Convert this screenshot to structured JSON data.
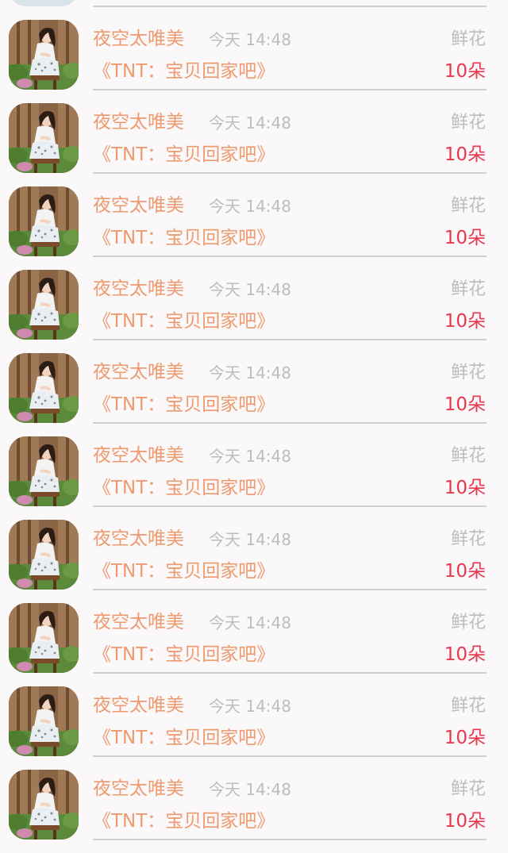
{
  "rows": [
    {
      "name": "夜空太唯美",
      "time": "今天 14:48",
      "gift_label": "鲜花",
      "title": "《TNT：宝贝回家吧》",
      "count": "10朵"
    },
    {
      "name": "夜空太唯美",
      "time": "今天 14:48",
      "gift_label": "鲜花",
      "title": "《TNT：宝贝回家吧》",
      "count": "10朵"
    },
    {
      "name": "夜空太唯美",
      "time": "今天 14:48",
      "gift_label": "鲜花",
      "title": "《TNT：宝贝回家吧》",
      "count": "10朵"
    },
    {
      "name": "夜空太唯美",
      "time": "今天 14:48",
      "gift_label": "鲜花",
      "title": "《TNT：宝贝回家吧》",
      "count": "10朵"
    },
    {
      "name": "夜空太唯美",
      "time": "今天 14:48",
      "gift_label": "鲜花",
      "title": "《TNT：宝贝回家吧》",
      "count": "10朵"
    },
    {
      "name": "夜空太唯美",
      "time": "今天 14:48",
      "gift_label": "鲜花",
      "title": "《TNT：宝贝回家吧》",
      "count": "10朵"
    },
    {
      "name": "夜空太唯美",
      "time": "今天 14:48",
      "gift_label": "鲜花",
      "title": "《TNT：宝贝回家吧》",
      "count": "10朵"
    },
    {
      "name": "夜空太唯美",
      "time": "今天 14:48",
      "gift_label": "鲜花",
      "title": "《TNT：宝贝回家吧》",
      "count": "10朵"
    },
    {
      "name": "夜空太唯美",
      "time": "今天 14:48",
      "gift_label": "鲜花",
      "title": "《TNT：宝贝回家吧》",
      "count": "10朵"
    },
    {
      "name": "夜空太唯美",
      "time": "今天 14:48",
      "gift_label": "鲜花",
      "title": "《TNT：宝贝回家吧》",
      "count": "10朵"
    }
  ],
  "colors": {
    "accent": "#ee9a70",
    "count": "#e8384d",
    "muted": "#bdbdbd",
    "divider": "#cfcfcf",
    "background": "#faf8f8"
  },
  "icons": {
    "avatar": "user-photo-avatar"
  }
}
